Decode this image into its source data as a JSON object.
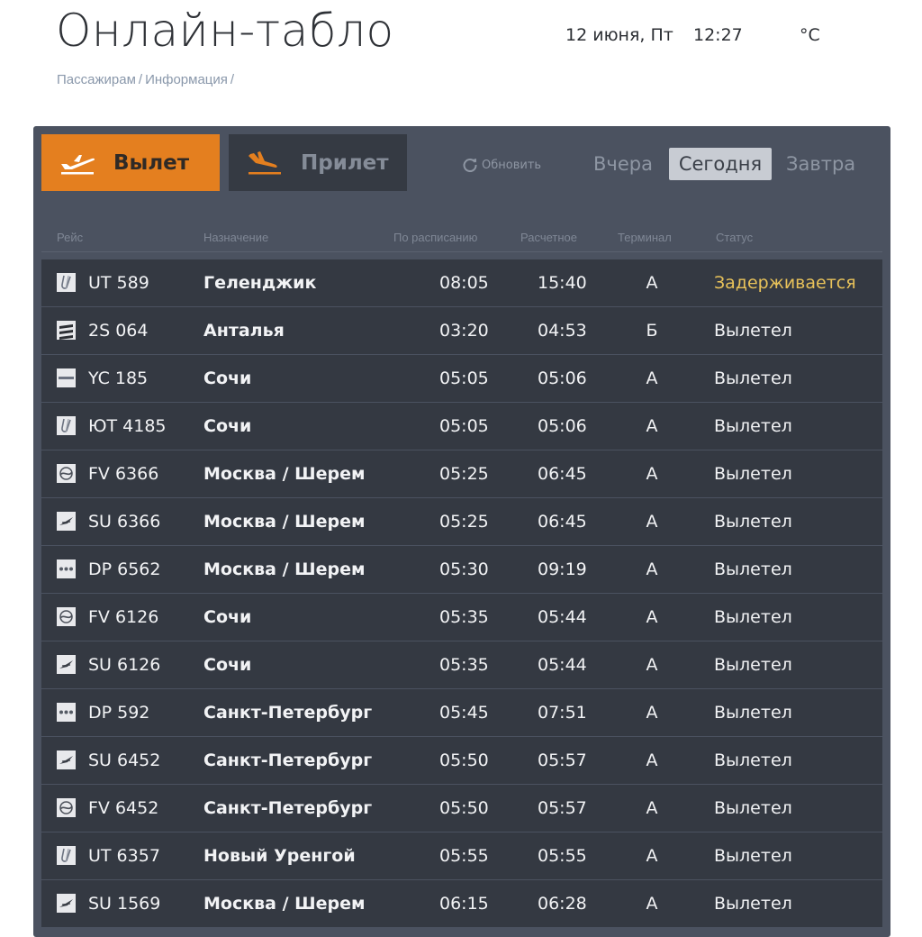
{
  "title": "Онлайн-табло",
  "header": {
    "date": "12 июня, Пт",
    "time": "12:27",
    "temp": "°C"
  },
  "breadcrumb": [
    "Пассажирам",
    "Информация"
  ],
  "tabs": {
    "departure": "Вылет",
    "arrival": "Прилет"
  },
  "refresh_label": "Обновить",
  "days": {
    "yesterday": "Вчера",
    "today": "Сегодня",
    "tomorrow": "Завтра"
  },
  "columns": {
    "flight": "Рейс",
    "destination": "Назначение",
    "scheduled": "По расписанию",
    "estimated": "Расчетное",
    "terminal": "Терминал",
    "status": "Статус"
  },
  "colors": {
    "accent": "#e47f1f",
    "delayed": "#e8c25a",
    "board": "#4b5260",
    "row": "#343942"
  },
  "flights": [
    {
      "logo": "utair-logo",
      "flight": "UT 589",
      "dest": "Геленджик",
      "sched": "08:05",
      "est": "15:40",
      "term": "A",
      "status": "Задерживается",
      "delayed": true
    },
    {
      "logo": "s7-logo",
      "flight": "2S 064",
      "dest": "Анталья",
      "sched": "03:20",
      "est": "04:53",
      "term": "Б",
      "status": "Вылетел"
    },
    {
      "logo": "yc-logo",
      "flight": "YC 185",
      "dest": "Сочи",
      "sched": "05:05",
      "est": "05:06",
      "term": "A",
      "status": "Вылетел"
    },
    {
      "logo": "utair-logo",
      "flight": "ЮТ 4185",
      "dest": "Сочи",
      "sched": "05:05",
      "est": "05:06",
      "term": "A",
      "status": "Вылетел"
    },
    {
      "logo": "rossiya-logo",
      "flight": "FV 6366",
      "dest": "Москва / Шерем",
      "sched": "05:25",
      "est": "06:45",
      "term": "A",
      "status": "Вылетел"
    },
    {
      "logo": "aeroflot-logo",
      "flight": "SU 6366",
      "dest": "Москва / Шерем",
      "sched": "05:25",
      "est": "06:45",
      "term": "A",
      "status": "Вылетел"
    },
    {
      "logo": "pobeda-logo",
      "flight": "DP 6562",
      "dest": "Москва / Шерем",
      "sched": "05:30",
      "est": "09:19",
      "term": "A",
      "status": "Вылетел"
    },
    {
      "logo": "rossiya-logo",
      "flight": "FV 6126",
      "dest": "Сочи",
      "sched": "05:35",
      "est": "05:44",
      "term": "A",
      "status": "Вылетел"
    },
    {
      "logo": "aeroflot-logo",
      "flight": "SU 6126",
      "dest": "Сочи",
      "sched": "05:35",
      "est": "05:44",
      "term": "A",
      "status": "Вылетел"
    },
    {
      "logo": "pobeda-logo",
      "flight": "DP 592",
      "dest": "Санкт-Петербург",
      "sched": "05:45",
      "est": "07:51",
      "term": "A",
      "status": "Вылетел"
    },
    {
      "logo": "aeroflot-logo",
      "flight": "SU 6452",
      "dest": "Санкт-Петербург",
      "sched": "05:50",
      "est": "05:57",
      "term": "A",
      "status": "Вылетел"
    },
    {
      "logo": "rossiya-logo",
      "flight": "FV 6452",
      "dest": "Санкт-Петербург",
      "sched": "05:50",
      "est": "05:57",
      "term": "A",
      "status": "Вылетел"
    },
    {
      "logo": "utair-logo",
      "flight": "UT 6357",
      "dest": "Новый Уренгой",
      "sched": "05:55",
      "est": "05:55",
      "term": "A",
      "status": "Вылетел"
    },
    {
      "logo": "aeroflot-logo",
      "flight": "SU 1569",
      "dest": "Москва / Шерем",
      "sched": "06:15",
      "est": "06:28",
      "term": "A",
      "status": "Вылетел"
    }
  ]
}
